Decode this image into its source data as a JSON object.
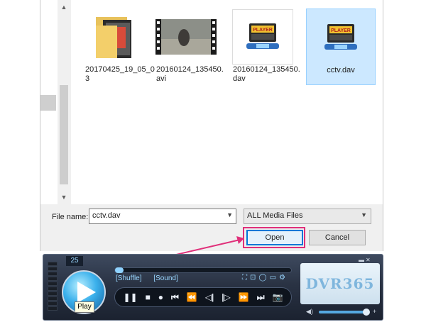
{
  "dialog": {
    "files": [
      {
        "name_line1": "20170425_19_05_0",
        "name_line2": "3",
        "kind": "folder-icon"
      },
      {
        "name_line1": "20160124_135450.",
        "name_line2": "avi",
        "kind": "video-thumbnail"
      },
      {
        "name_line1": "20160124_135450.",
        "name_line2": "dav",
        "kind": "player-file-icon"
      },
      {
        "name_line1": "cctv.dav",
        "name_line2": "",
        "kind": "player-file-icon",
        "selected": true
      }
    ],
    "player_badge": "PLAYER",
    "file_name_label": "File name:",
    "file_name_value": "cctv.dav",
    "file_type_value": "ALL Media Files",
    "open_label": "Open",
    "cancel_label": "Cancel"
  },
  "player": {
    "timer": "25",
    "play_tooltip": "Play",
    "shuffle_label": "[Shuffle]",
    "sound_label": "[Sound]",
    "brand": "DVR365",
    "controls": [
      "pause-icon",
      "stop-icon",
      "record-icon",
      "previous-icon",
      "rewind-icon",
      "step-back-icon",
      "step-forward-icon",
      "fast-forward-icon",
      "next-icon",
      "snapshot-icon"
    ]
  },
  "colors": {
    "annotation": "#e0307a",
    "selection": "#cce8ff",
    "accent": "#0078d7"
  }
}
